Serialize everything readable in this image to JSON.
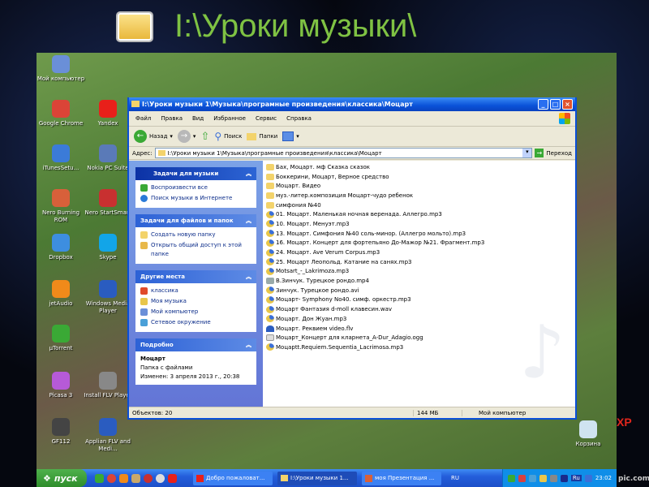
{
  "slide_title": "I:\\Уроки музыки\\",
  "xp_label": "XP",
  "watermark": "pic.com",
  "desktop_icons": [
    {
      "label": "Мой компьютер",
      "color": "#6a8fd8"
    },
    {
      "label": "Google Chrome",
      "color": "#db4437"
    },
    {
      "label": "Yandex",
      "color": "#e8201a"
    },
    {
      "label": "iTunesSetu...",
      "color": "#3b7bd8"
    },
    {
      "label": "Nokia PC Suite",
      "color": "#5a7ab8"
    },
    {
      "label": "Nero Burning ROM",
      "color": "#d8603a"
    },
    {
      "label": "Nero StartSmart",
      "color": "#c83030"
    },
    {
      "label": "Dropbox",
      "color": "#3d8ee0"
    },
    {
      "label": "Skype",
      "color": "#12a5e8"
    },
    {
      "label": "jetAudio",
      "color": "#f08a1a"
    },
    {
      "label": "Windows Media Player",
      "color": "#2a5cc0"
    },
    {
      "label": "µTorrent",
      "color": "#3aa935"
    },
    {
      "label": "Picasa 3",
      "color": "#b65ad8"
    },
    {
      "label": "Install FLV Player",
      "color": "#888888"
    },
    {
      "label": "GF112",
      "color": "#444444"
    },
    {
      "label": "Applian FLV and Medi...",
      "color": "#2a5cc0"
    },
    {
      "label": "Корзина",
      "color": "#cfe3f0"
    }
  ],
  "window": {
    "title": "I:\\Уроки музыки 1\\Музыка\\програмные произведения\\классика\\Моцарт",
    "menu": [
      "Файл",
      "Правка",
      "Вид",
      "Избранное",
      "Сервис",
      "Справка"
    ],
    "toolbar": {
      "back": "Назад",
      "search": "Поиск",
      "folders": "Папки"
    },
    "address_label": "Адрес:",
    "address": "I:\\Уроки музыки 1\\Музыка\\програмные произведения\\класcика\\Моцарт",
    "go": "Переход",
    "panels": [
      {
        "title": "Задачи для музыки",
        "items": [
          "Воспроизвести все",
          "Поиск музыки в Интернете"
        ]
      },
      {
        "title": "Задачи для файлов и папок",
        "items": [
          "Создать новую папку",
          "Открыть общий доступ к этой папке"
        ]
      },
      {
        "title": "Другие места",
        "items": [
          "класcика",
          "Моя музыка",
          "Мой компьютер",
          "Сетевое окружение"
        ]
      }
    ],
    "details": {
      "title": "Подробно",
      "name": "Моцарт",
      "type": "Папка с файлами",
      "modified": "Изменен: 3 апреля 2013 г., 20:38"
    },
    "files": [
      {
        "name": "Бах, Моцарт. мф Сказка сказок",
        "type": "folder"
      },
      {
        "name": "Боккерини, Моцарт, Верное средство",
        "type": "folder"
      },
      {
        "name": "Моцарт. Видео",
        "type": "folder"
      },
      {
        "name": "муз.-литер.композиция Моцарт-чудо ребенок",
        "type": "folder"
      },
      {
        "name": "симфония №40",
        "type": "folder"
      },
      {
        "name": "01. Моцарт. Маленькая ночная веренада. Аллегро.mp3",
        "type": "audio"
      },
      {
        "name": "10. Моцарт. Менуэт.mp3",
        "type": "audio"
      },
      {
        "name": "13. Моцарт. Симфония №40 соль-минор. (Аллегро мольто).mp3",
        "type": "audio"
      },
      {
        "name": "16. Моцарт. Концерт для фортепьяно До-Мажор №21. Фрагмент.mp3",
        "type": "audio"
      },
      {
        "name": "24. Моцарт. Ave Verum Corpus.mp3",
        "type": "audio"
      },
      {
        "name": "25. Моцарт Леопольд. Катание на санях.mp3",
        "type": "audio"
      },
      {
        "name": "Motsart_-_Lakrimoza.mp3",
        "type": "audio"
      },
      {
        "name": "В.Зинчук. Турецкое рондо.mp4",
        "type": "video"
      },
      {
        "name": "Зинчук. Турецкое рондо.avi",
        "type": "audio"
      },
      {
        "name": "Моцарт- Symphony No40. симф. оркестр.mp3",
        "type": "audio"
      },
      {
        "name": "Моцарт Фантазия d-moll клавесин.wav",
        "type": "audio"
      },
      {
        "name": "Моцарт. Дон Жуан.mp3",
        "type": "audio"
      },
      {
        "name": "Моцарт. Реквием video.flv",
        "type": "flv"
      },
      {
        "name": "Моцарт_Концерт для кларнета_A-Dur_Adagio.ogg",
        "type": "ogg"
      },
      {
        "name": "Моцарtt.Requiem.Sequentia_Lacrimosa.mp3",
        "type": "audio"
      }
    ],
    "status": {
      "objects": "Объектов: 20",
      "size": "144 МБ",
      "location": "Мой компьютер"
    }
  },
  "taskbar": {
    "start": "пуск",
    "tasks": [
      "Добро пожаловат...",
      "I:\\Уроки музыки 1...",
      "моя Презентация ..."
    ],
    "lang": "RU",
    "tray_lang": "Ru",
    "clock": "23:02"
  }
}
